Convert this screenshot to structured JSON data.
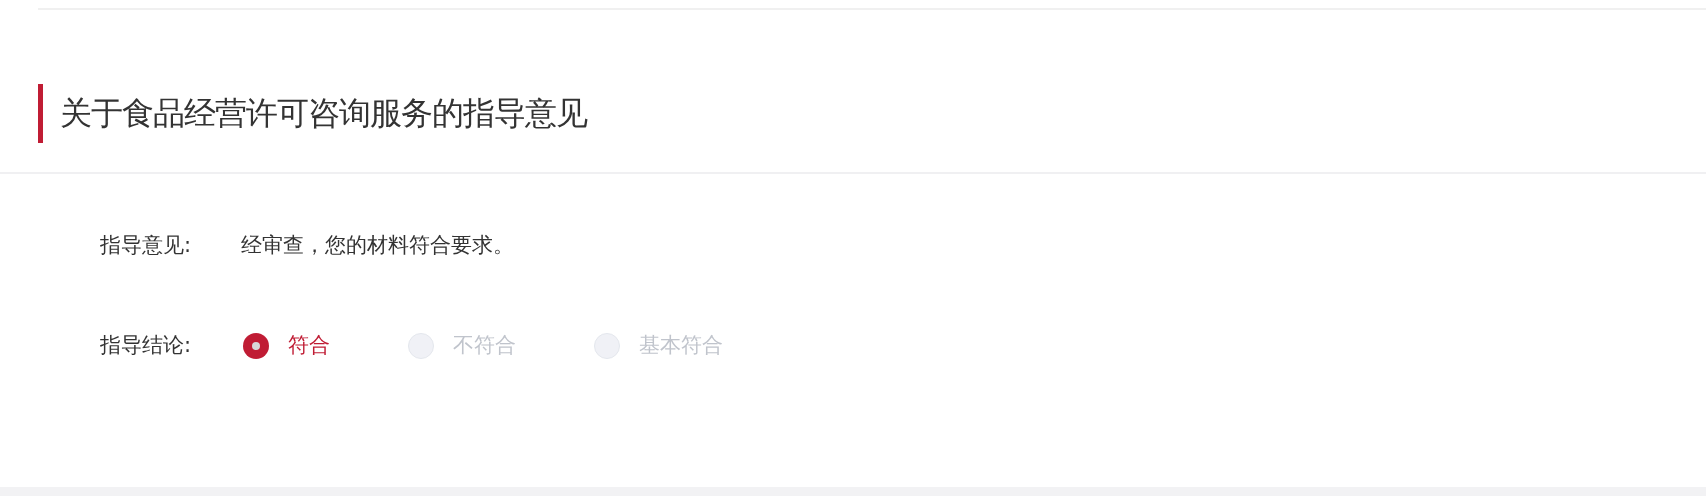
{
  "section": {
    "title": "关于食品经营许可咨询服务的指导意见"
  },
  "fields": [
    {
      "label": "指导意见:",
      "value": "经审查，您的材料符合要求。"
    }
  ],
  "conclusion": {
    "label": "指导结论:",
    "options": [
      {
        "label": "符合",
        "selected": true,
        "disabled": false
      },
      {
        "label": "不符合",
        "selected": false,
        "disabled": true
      },
      {
        "label": "基本符合",
        "selected": false,
        "disabled": true
      }
    ]
  }
}
